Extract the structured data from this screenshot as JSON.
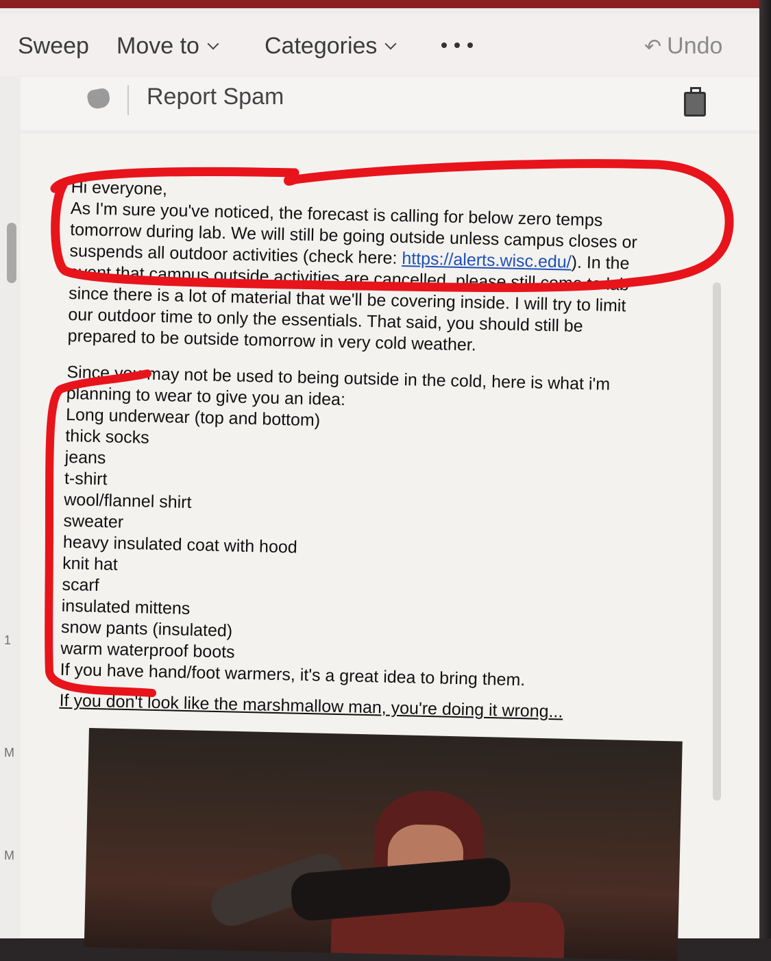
{
  "toolbar": {
    "sweep": "Sweep",
    "move_to": "Move to",
    "categories": "Categories",
    "undo": "Undo"
  },
  "spambar": {
    "report_spam": "Report Spam"
  },
  "sidebar": {
    "letters": [
      "1",
      "M",
      "M"
    ]
  },
  "email": {
    "greeting": "Hi everyone,",
    "para1_lines": [
      "As I'm sure you've noticed, the forecast is calling for below zero temps",
      "tomorrow during lab. We will still be going outside unless campus closes or",
      "suspends all outdoor activities (check here: ",
      "https://alerts.wisc.edu/",
      "). In the",
      "event that campus outside activities are cancelled, please still come to lab",
      "since there is a lot of material that we'll be covering inside. I will try to limit",
      "our outdoor time to only the essentials. That said, you should still be",
      "prepared to be outside tomorrow in very cold weather."
    ],
    "para2_lines": [
      "Since you may not be used to being outside in the cold, here is what i'm",
      "planning to wear to give you an idea:"
    ],
    "clothing_list": [
      "Long underwear (top and bottom)",
      "thick socks",
      "jeans",
      "t-shirt",
      "wool/flannel shirt",
      "sweater",
      "heavy insulated coat with hood",
      "knit hat",
      "scarf",
      "insulated mittens",
      "snow pants (insulated)",
      "warm waterproof boots"
    ],
    "warmers_note": "If you have hand/foot warmers, it's a great idea to bring them.",
    "caption": "If you don't look like the marshmallow man, you're doing it wrong..."
  },
  "colors": {
    "annotation": "#e8141b",
    "link": "#1f4fb6",
    "top_strip": "#8a1f1f"
  },
  "icons": [
    "chevron-down-icon",
    "more-icon",
    "undo-icon",
    "spam-icon",
    "trash-icon"
  ]
}
